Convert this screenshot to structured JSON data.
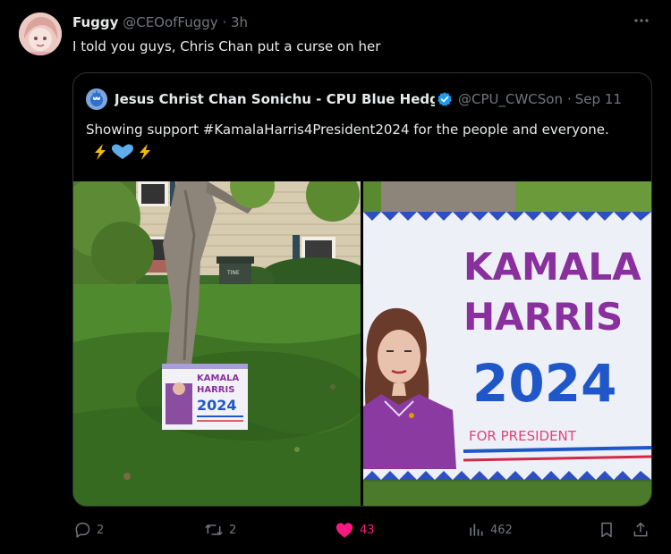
{
  "post": {
    "display_name": "Fuggy",
    "handle": "@CEOofFuggy",
    "separator": "·",
    "time": "3h",
    "text": "I told you guys, Chris Chan put a curse on her",
    "more_icon": "more-horizontal-icon"
  },
  "quoted": {
    "display_name": "Jesus Christ Chan Sonichu - CPU Blue Hedgehog",
    "handle": "@CPU_CWCSonichu",
    "separator": "·",
    "date": "Sep 11",
    "text": "Showing support #KamalaHarris4President2024 for the people and everyone.",
    "emojis": "⚡💙⚡",
    "sign": {
      "line1": "KAMALA",
      "line2": "HARRIS",
      "year": "2024",
      "tagline": "FOR PRESIDENT"
    },
    "small_sign": {
      "line1": "KAMALA",
      "line2": "HARRIS",
      "year": "2024"
    },
    "trash_label": "TINE"
  },
  "actions": {
    "replies": "2",
    "reposts": "2",
    "likes": "43",
    "views": "462"
  },
  "colors": {
    "background": "#000000",
    "text": "#e7e9ea",
    "secondary": "#71767b",
    "like": "#f91880",
    "verified": "#1d9bf0",
    "sign_purple": "#8a2f9e",
    "sign_blue": "#1f57c9"
  }
}
